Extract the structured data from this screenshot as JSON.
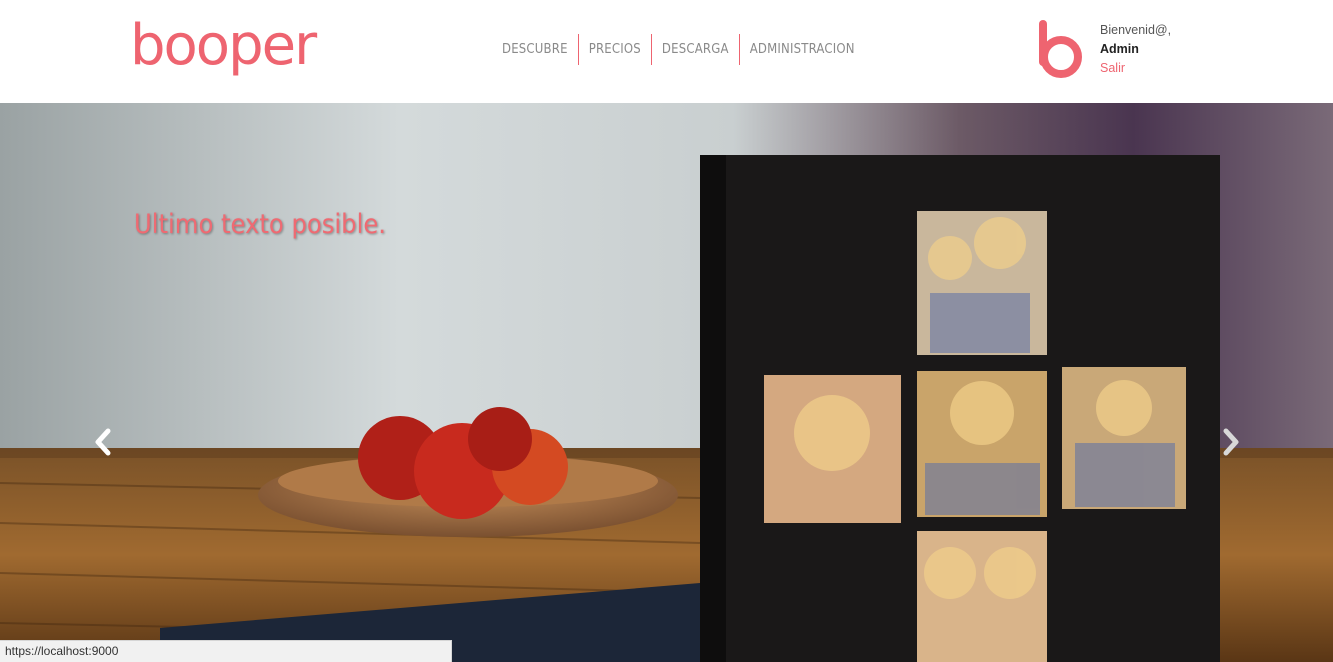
{
  "brand": {
    "name": "booper",
    "accent_color": "#ee6470",
    "icon": "booper-b-logo-icon"
  },
  "nav": {
    "items": [
      {
        "label": "DESCUBRE"
      },
      {
        "label": "PRECIOS"
      },
      {
        "label": "DESCARGA"
      },
      {
        "label": "ADMINISTRACION"
      }
    ]
  },
  "user": {
    "greeting": "Bienvenid@,",
    "name": "Admin",
    "logout_label": "Salir"
  },
  "hero": {
    "caption": "Ultimo texto posible.",
    "prev_icon": "chevron-left-icon",
    "next_icon": "chevron-right-icon"
  },
  "status_bar": {
    "url": "https://localhost:9000"
  }
}
